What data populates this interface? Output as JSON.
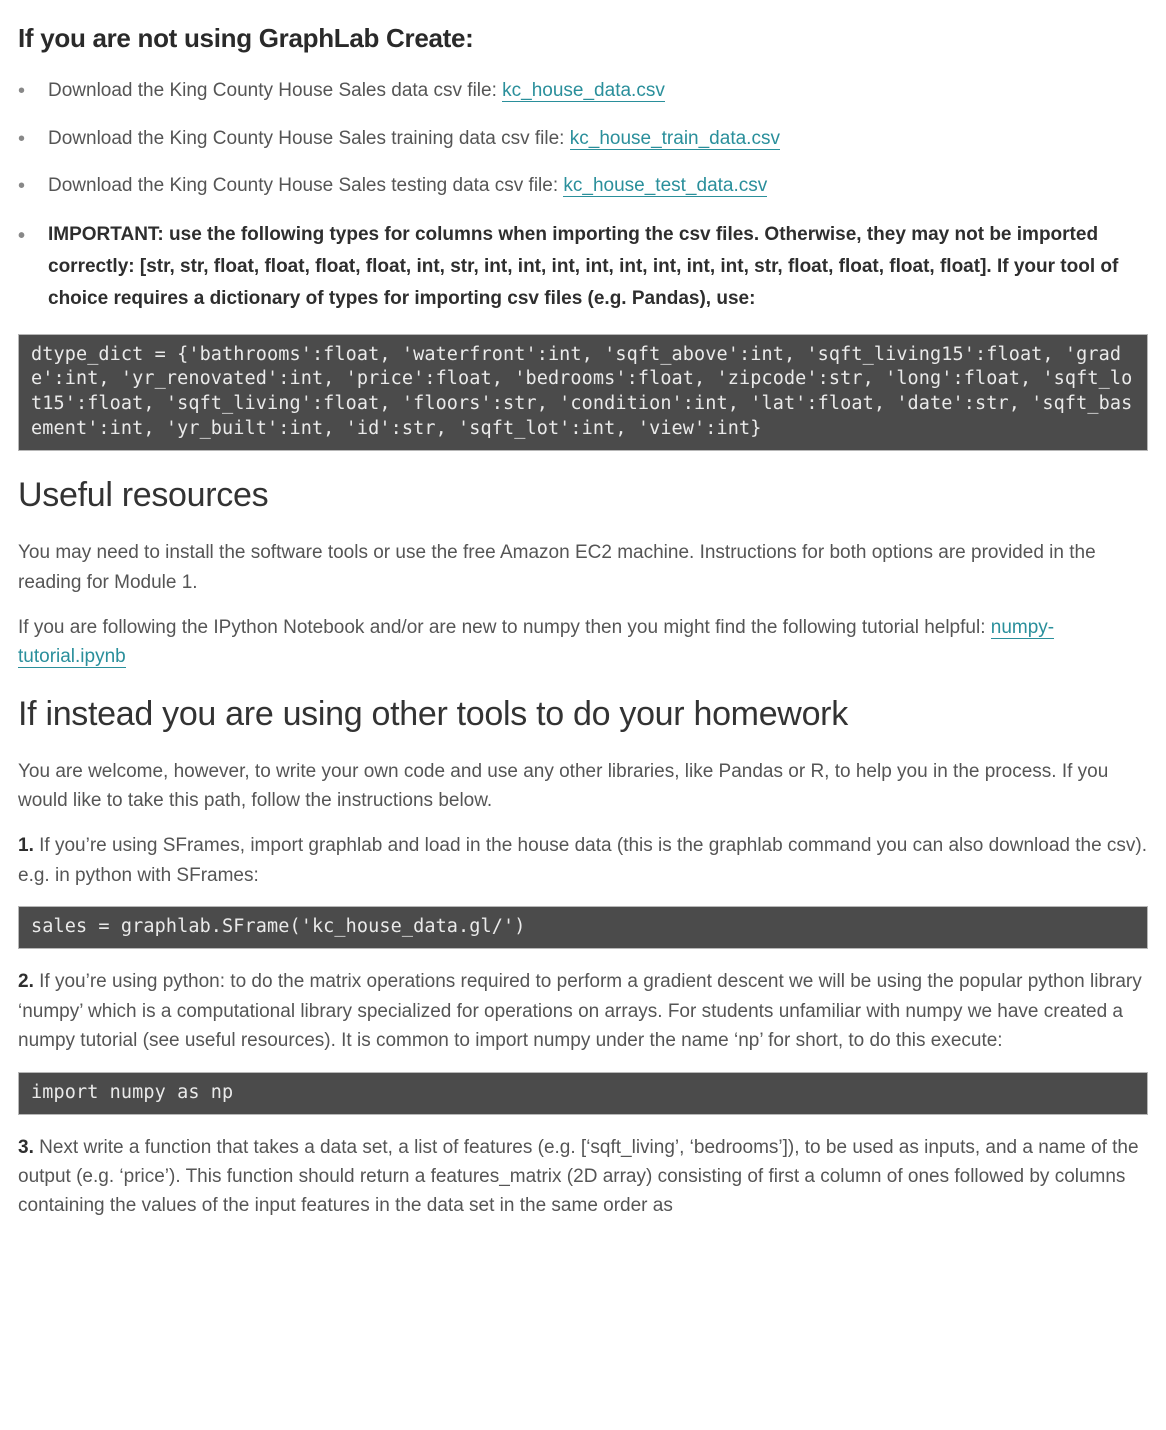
{
  "h2_title": "If you are not using GraphLab Create:",
  "bullets": [
    {
      "prefix": "Download the King County House Sales data csv file: ",
      "link": "kc_house_data.csv"
    },
    {
      "prefix": "Download the King County House Sales training data csv file: ",
      "link": "kc_house_train_data.csv"
    },
    {
      "prefix": "Download the King County House Sales testing data csv file: ",
      "link": "kc_house_test_data.csv"
    }
  ],
  "important_bullet": "IMPORTANT: use the following types for columns when importing the csv files. Otherwise, they may not be imported correctly: [str, str, float, float, float, float, int, str, int, int, int, int, int, int, int, int, str, float, float, float, float]. If your tool of choice requires a dictionary of types for importing csv files (e.g. Pandas), use:",
  "code1": "dtype_dict = {'bathrooms':float, 'waterfront':int, 'sqft_above':int, 'sqft_living15':float, 'grade':int, 'yr_renovated':int, 'price':float, 'bedrooms':float, 'zipcode':str, 'long':float, 'sqft_lot15':float, 'sqft_living':float, 'floors':str, 'condition':int, 'lat':float, 'date':str, 'sqft_basement':int, 'yr_built':int, 'id':str, 'sqft_lot':int, 'view':int}",
  "section_useful": "Useful resources",
  "useful_p1": "You may need to install the software tools or use the free Amazon EC2 machine. Instructions for both options are provided in the reading for Module 1.",
  "useful_p2_prefix": "If you are following the IPython Notebook and/or are new to numpy then you might find the following tutorial helpful: ",
  "useful_p2_link": "numpy-tutorial.ipynb",
  "section_other": "If instead you are using other tools to do your homework",
  "other_p1": "You are welcome, however, to write your own code and use any other libraries, like Pandas or R, to help you in the process. If you would like to take this path, follow the instructions below.",
  "step1_num": "1.",
  "step1_text": " If you’re using SFrames, import graphlab and load in the house data (this is the graphlab command you can also download the csv). e.g. in python with SFrames:",
  "code2": "sales = graphlab.SFrame('kc_house_data.gl/')",
  "step2_num": "2.",
  "step2_text": " If you’re using python: to do the matrix operations required to perform a gradient descent we will be using the popular python library ‘numpy’ which is a computational library specialized for operations on arrays. For students unfamiliar with numpy we have created a numpy tutorial (see useful resources). It is common to import numpy under the name ‘np’ for short, to do this execute:",
  "code3": "import numpy as np",
  "step3_num": "3.",
  "step3_text": " Next write a function that takes a data set, a list of features (e.g. [‘sqft_living’, ‘bedrooms’]), to be used as inputs, and a name of the output (e.g. ‘price’). This function should return a features_matrix (2D array) consisting of first a column of ones followed by columns containing the values of the input features in the data set in the same order as"
}
